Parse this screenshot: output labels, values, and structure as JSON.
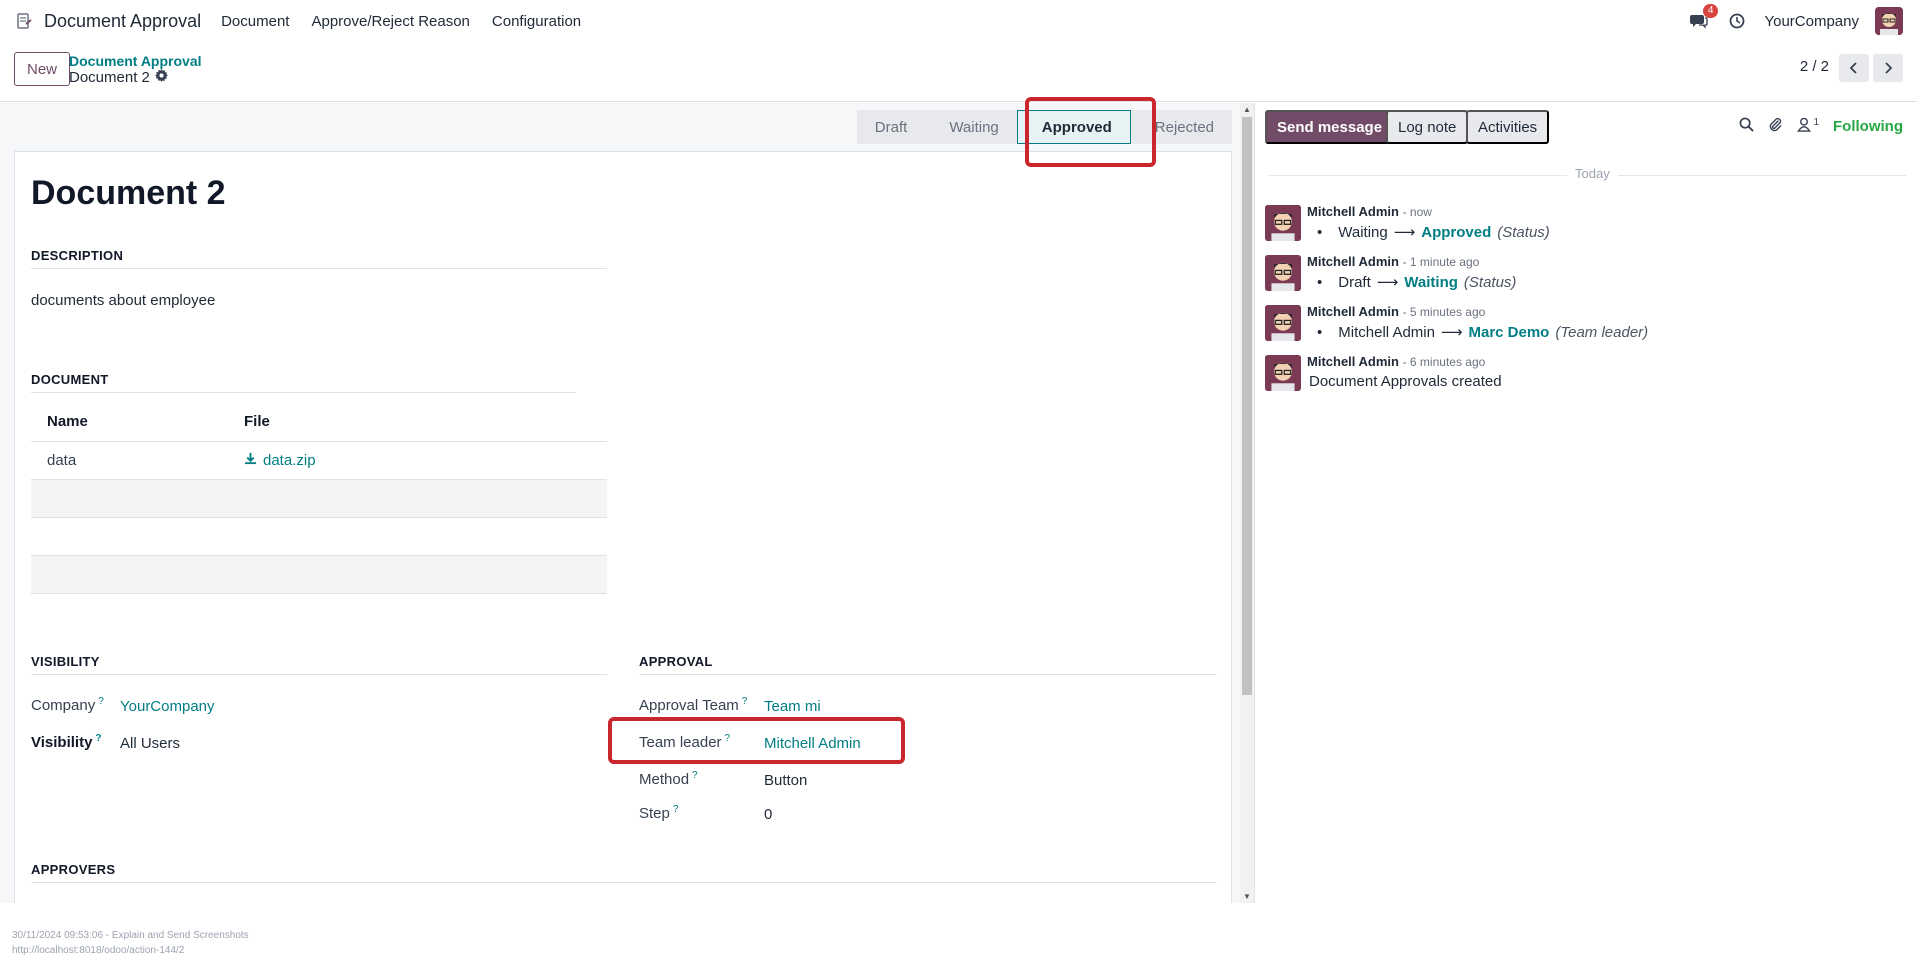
{
  "navbar": {
    "app_name": "Document Approval",
    "menus": [
      "Document",
      "Approve/Reject Reason",
      "Configuration"
    ],
    "messages_badge": "4",
    "company": "YourCompany"
  },
  "control_panel": {
    "new_label": "New",
    "breadcrumb_parent": "Document Approval",
    "breadcrumb_current": "Document 2",
    "pager": "2 / 2"
  },
  "statusbar": {
    "stages": [
      "Draft",
      "Waiting",
      "Approved",
      "Rejected"
    ],
    "active": "Approved"
  },
  "form": {
    "title": "Document 2",
    "description_title": "DESCRIPTION",
    "description_text": "documents about employee",
    "document_title": "DOCUMENT",
    "table": {
      "headers": [
        "Name",
        "File"
      ],
      "rows": [
        {
          "name": "data",
          "file": "data.zip"
        }
      ]
    },
    "visibility_title": "VISIBILITY",
    "company_label": "Company",
    "company_value": "YourCompany",
    "visibility_label": "Visibility",
    "visibility_value": "All Users",
    "approval_title": "APPROVAL",
    "approval_team_label": "Approval Team",
    "approval_team_value": "Team mi",
    "team_leader_label": "Team leader",
    "team_leader_value": "Mitchell Admin",
    "method_label": "Method",
    "method_value": "Button",
    "step_label": "Step",
    "step_value": "0",
    "approvers_title": "APPROVERS",
    "help_mark": "?"
  },
  "chatter": {
    "send_message": "Send message",
    "log_note": "Log note",
    "activities": "Activities",
    "followers_count": "1",
    "following": "Following",
    "today": "Today",
    "messages": [
      {
        "author": "Mitchell Admin",
        "date": "- now",
        "old": "Waiting",
        "new": "Approved",
        "field": "(Status)"
      },
      {
        "author": "Mitchell Admin",
        "date": "- 1 minute ago",
        "old": "Draft",
        "new": "Waiting",
        "field": "(Status)"
      },
      {
        "author": "Mitchell Admin",
        "date": "- 5 minutes ago",
        "old": "Mitchell Admin",
        "new": "Marc Demo",
        "field": "(Team leader)"
      },
      {
        "author": "Mitchell Admin",
        "date": "- 6 minutes ago",
        "text": "Document Approvals created"
      }
    ]
  },
  "footer": {
    "line1": "30/11/2024 09:53:06 - Explain and Send Screenshots",
    "line2": "http://localhost:8018/odoo/action-144/2"
  }
}
